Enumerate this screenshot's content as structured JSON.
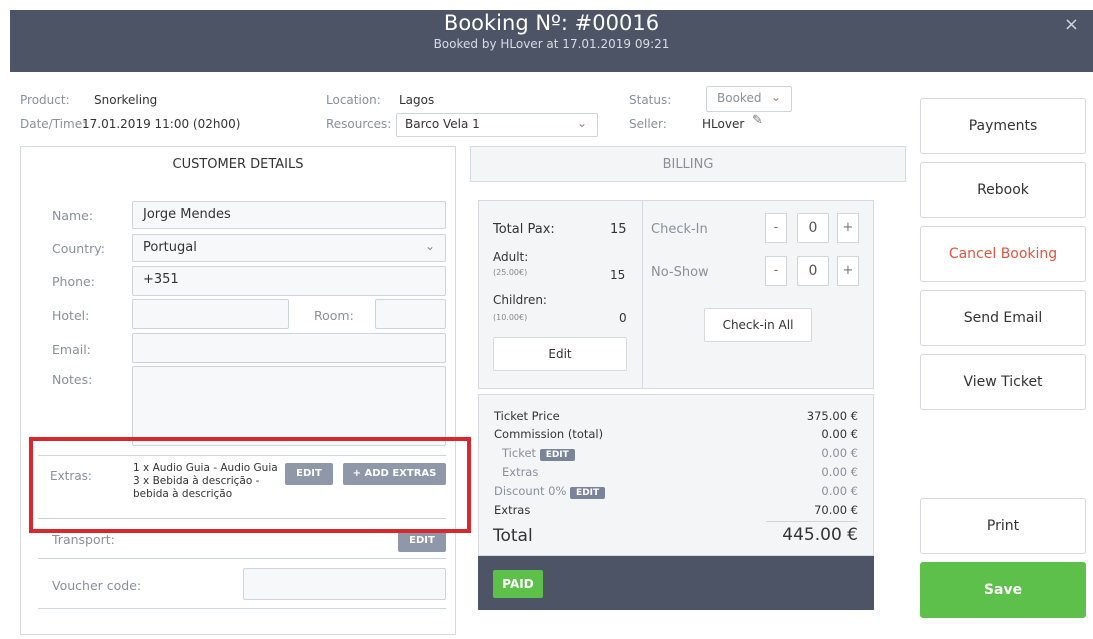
{
  "header": {
    "title": "Booking Nº: #00016",
    "subtitle": "Booked by HLover at 17.01.2019 09:21",
    "close": "×"
  },
  "meta": {
    "product_label": "Product:",
    "product_value": "Snorkeling",
    "datetime_label": "Date/Time:",
    "datetime_value": "17.01.2019 11:00 (02h00)",
    "location_label": "Location:",
    "location_value": "Lagos",
    "resources_label": "Resources:",
    "resources_value": "Barco Vela 1",
    "status_label": "Status:",
    "status_value": "Booked",
    "seller_label": "Seller:",
    "seller_value": "HLover"
  },
  "tabs": {
    "customer": "CUSTOMER DETAILS",
    "billing": "BILLING"
  },
  "customer": {
    "name_label": "Name:",
    "name_value": "Jorge Mendes",
    "country_label": "Country:",
    "country_value": "Portugal",
    "phone_label": "Phone:",
    "phone_value": "+351",
    "hotel_label": "Hotel:",
    "room_label": "Room:",
    "email_label": "Email:",
    "notes_label": "Notes:",
    "extras_label": "Extras:",
    "extras_lines": [
      "1 x Audio Guia - Audio Guia",
      "3 x Bebida à descrição -",
      "bebida à descrição"
    ],
    "extras_edit": "EDIT",
    "add_extras": "+ ADD EXTRAS",
    "transport_label": "Transport:",
    "transport_edit": "EDIT",
    "voucher_label": "Voucher code:"
  },
  "pax": {
    "total_label": "Total Pax:",
    "total_value": "15",
    "adult_label": "Adult:",
    "adult_price": "(25.00€)",
    "adult_value": "15",
    "children_label": "Children:",
    "children_price": "(10.00€)",
    "children_value": "0",
    "edit": "Edit",
    "checkin_label": "Check-In",
    "checkin_value": "0",
    "noshow_label": "No-Show",
    "noshow_value": "0",
    "minus": "-",
    "plus": "+",
    "checkin_all": "Check-in All"
  },
  "pricing": {
    "ticket_price_label": "Ticket Price",
    "ticket_price_value": "375.00 €",
    "commission_label": "Commission (total)",
    "commission_value": "0.00 €",
    "ticket_label": "Ticket",
    "ticket_value": "0.00 €",
    "extras_sub_label": "Extras",
    "extras_sub_value": "0.00 €",
    "discount_label": "Discount 0%",
    "discount_value": "0.00 €",
    "extras_label": "Extras",
    "extras_value": "70.00 €",
    "total_label": "Total",
    "total_value": "445.00 €",
    "edit_tag": "EDIT",
    "paid": "PAID"
  },
  "actions": {
    "payments": "Payments",
    "rebook": "Rebook",
    "cancel": "Cancel Booking",
    "send_email": "Send Email",
    "view_ticket": "View Ticket",
    "print": "Print",
    "save": "Save"
  },
  "colors": {
    "header_bg": "#4d5466",
    "accent_green": "#5cc04a",
    "cancel_red": "#e0533f",
    "highlight_red": "#d9272e"
  }
}
